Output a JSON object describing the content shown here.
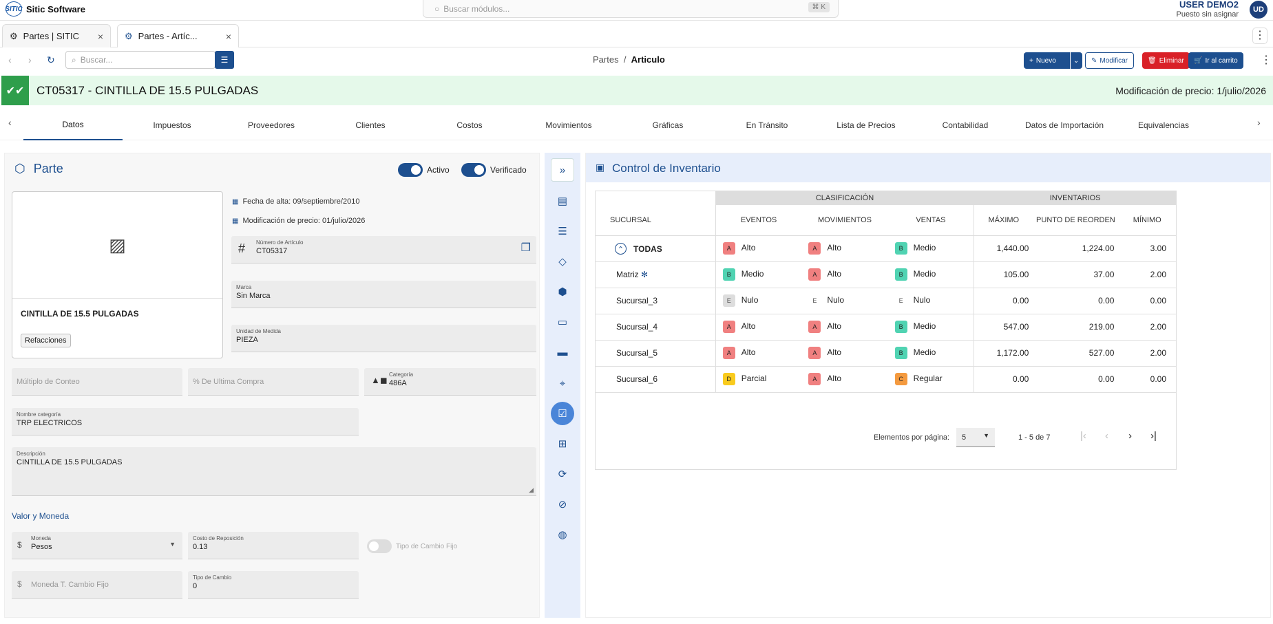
{
  "app": {
    "logo_mark": "SITIC",
    "name": "Sitic Software",
    "search_placeholder": "Buscar módulos...",
    "search_shortcut": "⌘ K",
    "user_name": "USER DEMO2",
    "user_role": "Puesto sin asignar",
    "user_initials": "UD"
  },
  "tabs": [
    {
      "label": "Partes | SITIC"
    },
    {
      "label": "Partes - Artíc..."
    }
  ],
  "nav": {
    "search_placeholder": "Buscar...",
    "breadcrumb_parent": "Partes",
    "breadcrumb_current": "Articulo"
  },
  "actions": {
    "new": "Nuevo",
    "modify": "Modificar",
    "delete": "Eliminar",
    "cart": "Ir al carrito"
  },
  "banner": {
    "title": "CT05317 - CINTILLA DE 15.5 PULGADAS",
    "price_mod": "Modificación de precio: 1/julio/2026"
  },
  "detail_tabs": [
    "Datos",
    "Impuestos",
    "Proveedores",
    "Clientes",
    "Costos",
    "Movimientos",
    "Gráficas",
    "En Tránsito",
    "Lista de Precios",
    "Contabilidad",
    "Datos de Importación",
    "Equivalencias"
  ],
  "part": {
    "title": "Parte",
    "active_label": "Activo",
    "verified_label": "Verificado",
    "name": "CINTILLA DE 15.5 PULGADAS",
    "chip": "Refacciones",
    "fecha_alta": "Fecha de alta: 09/septiembre/2010",
    "mod_precio": "Modificación de precio: 01/julio/2026",
    "numero_label": "Número de Artículo",
    "numero": "CT05317",
    "marca_label": "Marca",
    "marca": "Sin Marca",
    "unidad_label": "Unidad de Medida",
    "unidad": "PIEZA",
    "multiplo_ph": "Múltiplo de Conteo",
    "ultima_ph": "% De Ultima Compra",
    "categoria_label": "Categoría",
    "categoria": "486A",
    "nombre_cat_label": "Nombre categoría",
    "nombre_cat": "TRP ELECTRICOS",
    "descripcion_label": "Descripción",
    "descripcion": "CINTILLA DE 15.5 PULGADAS",
    "valor_title": "Valor y Moneda",
    "moneda_label": "Moneda",
    "moneda": "Pesos",
    "costo_label": "Costo de Reposición",
    "costo": "0.13",
    "tipo_fijo_label": "Tipo de Cambio Fijo",
    "moneda_fijo_ph": "Moneda T. Cambio Fijo",
    "tipo_cambio_label": "Tipo de Cambio",
    "tipo_cambio": "0"
  },
  "inventory": {
    "title": "Control de Inventario",
    "group_clasificacion": "CLASIFICACIÓN",
    "group_inventarios": "INVENTARIOS",
    "headers": [
      "SUCURSAL",
      "EVENTOS",
      "MOVIMIENTOS",
      "VENTAS",
      "MÁXIMO",
      "PUNTO DE REORDEN",
      "MÍNIMO"
    ],
    "total_label": "TODAS",
    "rows": [
      {
        "suc": "TODAS",
        "ev": [
          "A",
          "Alto"
        ],
        "mov": [
          "A",
          "Alto"
        ],
        "ven": [
          "B",
          "Medio"
        ],
        "max": "1,440.00",
        "reo": "1,224.00",
        "min": "3.00"
      },
      {
        "suc": "Matriz",
        "ev": [
          "B",
          "Medio"
        ],
        "mov": [
          "A",
          "Alto"
        ],
        "ven": [
          "B",
          "Medio"
        ],
        "max": "105.00",
        "reo": "37.00",
        "min": "2.00"
      },
      {
        "suc": "Sucursal_3",
        "ev": [
          "E",
          "Nulo"
        ],
        "mov": [
          "E",
          "Nulo"
        ],
        "ven": [
          "E",
          "Nulo"
        ],
        "max": "0.00",
        "reo": "0.00",
        "min": "0.00"
      },
      {
        "suc": "Sucursal_4",
        "ev": [
          "A",
          "Alto"
        ],
        "mov": [
          "A",
          "Alto"
        ],
        "ven": [
          "B",
          "Medio"
        ],
        "max": "547.00",
        "reo": "219.00",
        "min": "2.00"
      },
      {
        "suc": "Sucursal_5",
        "ev": [
          "A",
          "Alto"
        ],
        "mov": [
          "A",
          "Alto"
        ],
        "ven": [
          "B",
          "Medio"
        ],
        "max": "1,172.00",
        "reo": "527.00",
        "min": "2.00"
      },
      {
        "suc": "Sucursal_6",
        "ev": [
          "D",
          "Parcial"
        ],
        "mov": [
          "A",
          "Alto"
        ],
        "ven": [
          "C",
          "Regular"
        ],
        "max": "0.00",
        "reo": "0.00",
        "min": "0.00"
      }
    ],
    "page_size_label": "Elementos por página:",
    "page_size": "5",
    "range": "1 - 5 de 7"
  }
}
